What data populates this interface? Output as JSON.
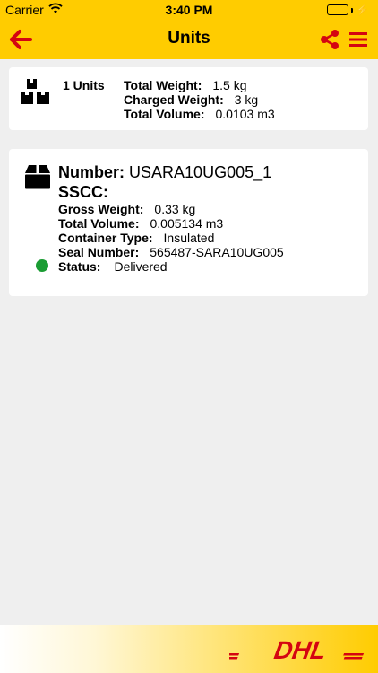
{
  "status_bar": {
    "carrier": "Carrier",
    "time": "3:40 PM"
  },
  "header": {
    "title": "Units",
    "back_icon": "arrow-left-icon",
    "share_icon": "share-icon",
    "menu_icon": "hamburger-menu-icon"
  },
  "summary": {
    "units_label": "1 Units",
    "rows": [
      {
        "label": "Total Weight:",
        "value": "1.5 kg"
      },
      {
        "label": "Charged Weight:",
        "value": "3 kg"
      },
      {
        "label": "Total Volume:",
        "value": "0.0103 m3"
      }
    ]
  },
  "unit": {
    "number_label": "Number:",
    "number_value": "USARA10UG005_1",
    "sscc_label": "SSCC:",
    "rows": [
      {
        "label": "Gross Weight:",
        "value": "0.33 kg"
      },
      {
        "label": "Total Volume:",
        "value": "0.005134 m3"
      },
      {
        "label": "Container Type:",
        "value": "Insulated"
      },
      {
        "label": "Seal Number:",
        "value": "565487-SARA10UG005"
      },
      {
        "label": "Status:",
        "value": "Delivered"
      }
    ],
    "status_color": "#1a9c33"
  },
  "footer": {
    "logo_text": "DHL"
  },
  "colors": {
    "brand_yellow": "#ffcc00",
    "brand_red": "#d40511"
  }
}
